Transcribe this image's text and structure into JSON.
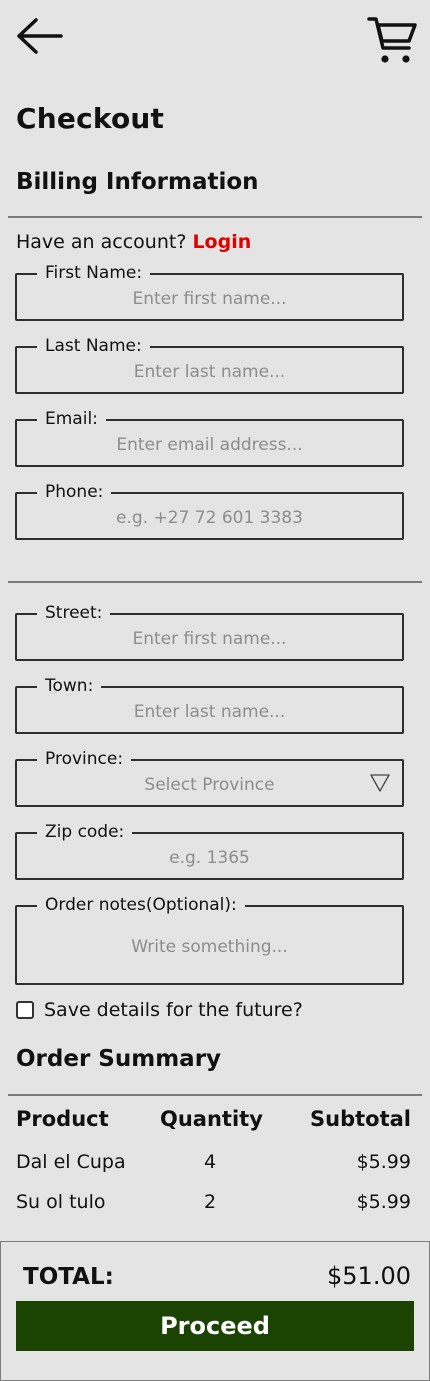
{
  "header": {
    "back_icon": "arrow-left-icon",
    "cart_icon": "shopping-cart-icon",
    "title": "Checkout"
  },
  "billing": {
    "heading": "Billing Information",
    "account_prompt": "Have an account?",
    "login_label": "Login",
    "fields": [
      {
        "label": "First Name:",
        "placeholder": "Enter first name..."
      },
      {
        "label": "Last Name:",
        "placeholder": "Enter last name..."
      },
      {
        "label": "Email:",
        "placeholder": "Enter email address..."
      },
      {
        "label": "Phone:",
        "placeholder": "e.g. +27 72 601 3383"
      }
    ]
  },
  "address": {
    "fields": [
      {
        "label": "Street:",
        "placeholder": "Enter first name..."
      },
      {
        "label": "Town:",
        "placeholder": "Enter last name..."
      },
      {
        "label": "Province:",
        "placeholder": "Select Province"
      },
      {
        "label": "Zip code:",
        "placeholder": "e.g. 1365"
      },
      {
        "label": "Order notes(Optional):",
        "placeholder": "Write something..."
      }
    ],
    "save_details_label": "Save details for the future?",
    "save_details_checked": false
  },
  "summary": {
    "heading": "Order Summary",
    "columns": [
      "Product",
      "Quantity",
      "Subtotal"
    ],
    "rows": [
      {
        "product": "Dal el Cupa",
        "quantity": "4",
        "subtotal": "$5.99"
      },
      {
        "product": "Su ol tulo",
        "quantity": "2",
        "subtotal": "$5.99"
      }
    ]
  },
  "footer": {
    "total_label": "TOTAL:",
    "total_value": "$51.00",
    "proceed_label": "Proceed"
  },
  "colors": {
    "background": "#e4e4e4",
    "login": "#e00000",
    "proceed": "#1b4403"
  }
}
